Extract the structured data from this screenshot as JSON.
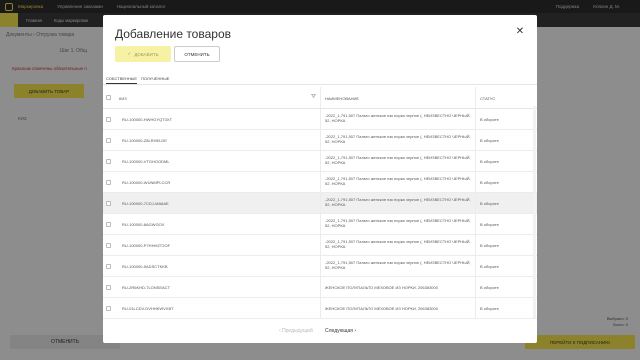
{
  "app": {
    "top_nav": [
      "Маркировка",
      "Управление заказами",
      "Национальный каталог"
    ],
    "support": "Поддержка",
    "user": "Кляхин Д. М.",
    "sub_nav": [
      "Главная",
      "Коды маркировки"
    ],
    "breadcrumb": "Документы",
    "page_title": "Отгрузка товара",
    "step": "Шаг 1. Общ",
    "warning": "Красным отмечены обязательные п",
    "add_goods": "ДОБАВИТЬ ТОВАР",
    "kiz_col": "КИЗ",
    "cancel": "ОТМЕНИТЬ",
    "send": "ПЕРЕЙТИ К ПОДПИСАНИЮ",
    "selected": "Выбрано: 0",
    "total": "Всего: 0"
  },
  "modal": {
    "title": "Добавление товаров",
    "add_label": "ДОБАВИТЬ",
    "cancel_label": "ОТМЕНИТЬ",
    "tabs": [
      "СОБСТВЕННЫЕ",
      "ПОЛУЧЕННЫЕ"
    ],
    "columns": {
      "kiz": "КИЗ",
      "name": "НАИМЕНОВАНИЕ",
      "status": "СТАТУС"
    },
    "rows": [
      {
        "kiz": "RU-100000-HWHGYQT3XT",
        "name": "-2022_1,791,507 Пальто женское нзк норка черное (, НЕИЗВЕСТНО ЧЕРНЫЙ, 52, НОРКА",
        "status": "В обороте"
      },
      {
        "kiz": "RU-100000-Z8LRHELDE",
        "name": "-2022_1,791,507 Пальто женское нзк норка черное (, НЕИЗВЕСТНО ЧЕРНЫЙ, 52, НОРКА",
        "status": "В обороте"
      },
      {
        "kiz": "RU-100000-VTGHOODML",
        "name": "-2022_1,791,507 Пальто женское нзк норка черное (, НЕИЗВЕСТНО ЧЕРНЫЙ, 52, НОРКА",
        "status": "В обороте"
      },
      {
        "kiz": "RU-100000-WUNMPLCCR",
        "name": "-2022_1,791,507 Пальто женское нзк норка черное (, НЕИЗВЕСТНО ЧЕРНЫЙ, 52, НОРКА",
        "status": "В обороте"
      },
      {
        "kiz": "RU-100000-7CDJ-MA6AE",
        "name": "-2022_1,791,507 Пальто женское нзк норка черное (, НЕИЗВЕСТНО ЧЕРНЫЙ, 52, НОРКА",
        "status": "В обороте"
      },
      {
        "kiz": "RU-100000-8AGWGOX",
        "name": "-2022_1,791,507 Пальто женское нзк норка черное (, НЕИЗВЕСТНО ЧЕРНЫЙ, 52, НОРКА",
        "status": "В обороте"
      },
      {
        "kiz": "RU-100000-P7HHHZT2OF",
        "name": "-2022_1,791,507 Пальто женское нзк норка черное (, НЕИЗВЕСТНО ЧЕРНЫЙ, 52, НОРКА",
        "status": "В обороте"
      },
      {
        "kiz": "RU-100000-9ADSCTKKB",
        "name": "-2022_1,791,507 Пальто женское нзк норка черное (, НЕИЗВЕСТНО ЧЕРНЫЙ, 52, НОРКА",
        "status": "В обороте"
      },
      {
        "kiz": "RU-2R6KHD-7LONSEACT",
        "name": "ЖЕНСКОЕ ПОЛУПАЛЬТО МЕХОВОЕ ИЗ НОРКИ, 206383000",
        "status": "В обороте"
      },
      {
        "kiz": "RU-01LCDV-DVHHKWVXBT",
        "name": "ЖЕНСКОЕ ПОЛУПАЛЬТО МЕХОВОЕ ИЗ НОРКИ, 206383000",
        "status": "В обороте"
      }
    ],
    "prev": "Предыдущий",
    "next": "Следующая",
    "highlighted_row": 4
  },
  "colors": {
    "accent": "#f2e04a",
    "topbar": "#2b2b2b"
  }
}
